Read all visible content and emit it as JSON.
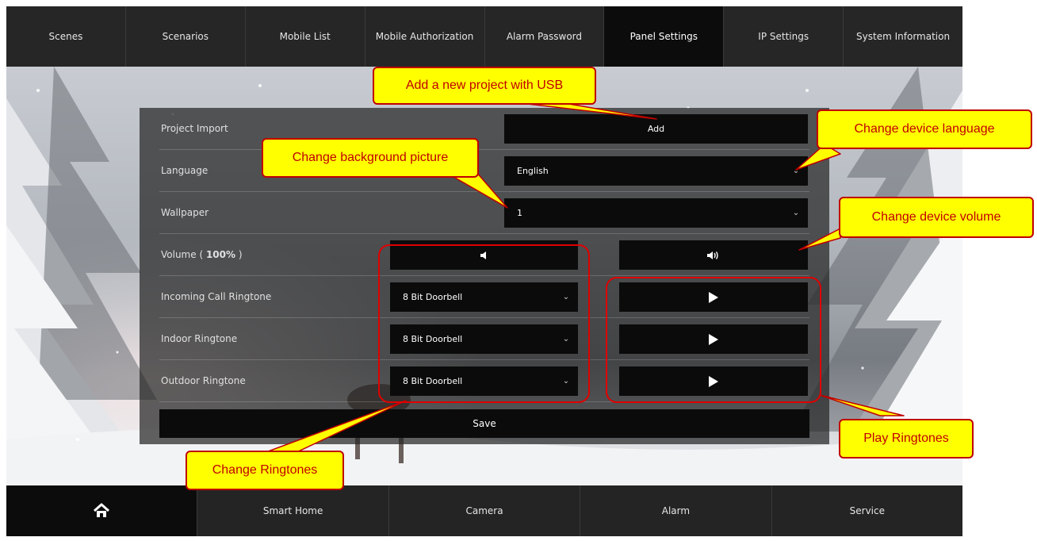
{
  "top_tabs": [
    "Scenes",
    "Scenarios",
    "Mobile List",
    "Mobile Authorization",
    "Alarm Password",
    "Panel Settings",
    "IP Settings",
    "System Information"
  ],
  "active_top_tab": "Panel Settings",
  "settings": {
    "project_import": {
      "label": "Project Import",
      "button": "Add"
    },
    "language": {
      "label": "Language",
      "value": "English"
    },
    "wallpaper": {
      "label": "Wallpaper",
      "value": "1"
    },
    "volume": {
      "label_prefix": "Volume ( ",
      "value": "100%",
      "label_suffix": " )"
    },
    "incoming_call_ringtone": {
      "label": "Incoming Call Ringtone",
      "value": "8 Bit Doorbell"
    },
    "indoor_ringtone": {
      "label": "Indoor Ringtone",
      "value": "8 Bit Doorbell"
    },
    "outdoor_ringtone": {
      "label": "Outdoor Ringtone",
      "value": "8 Bit Doorbell"
    },
    "save": "Save"
  },
  "icons": {
    "volume_down": "speaker-low-icon",
    "volume_up": "speaker-high-icon",
    "play": "play-icon",
    "home": "home-icon",
    "dropdown": "chevron-down-icon"
  },
  "bottom_tabs": {
    "smart_home": "Smart Home",
    "camera": "Camera",
    "alarm": "Alarm",
    "service": "Service"
  },
  "annotations": {
    "usb": "Add a new project with USB",
    "language": "Change device language",
    "background": "Change background picture",
    "volume": "Change device volume",
    "ringtones": "Change Ringtones",
    "play": "Play Ringtones"
  },
  "colors": {
    "callout_fill": "#ffff00",
    "callout_border": "#c00000",
    "active_tab": "#0c0c0c"
  }
}
